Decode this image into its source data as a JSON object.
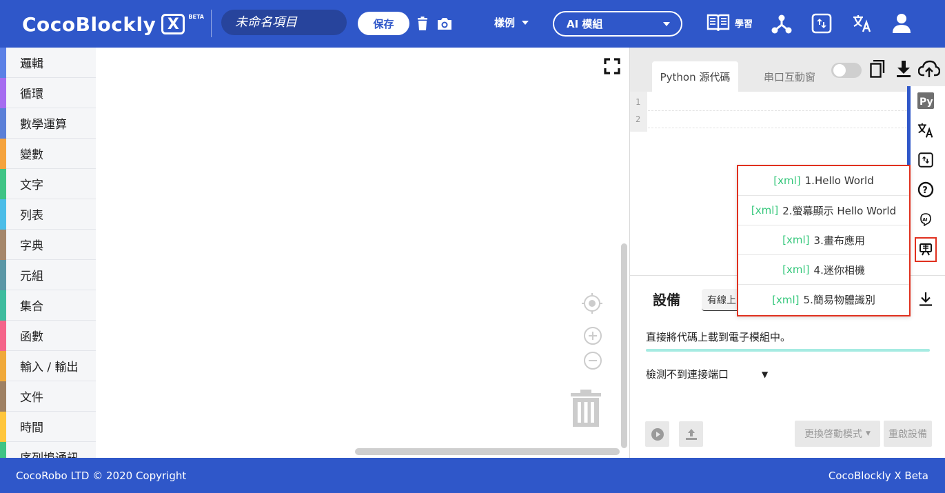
{
  "header": {
    "brand": "CocoBlockly",
    "brand_x": "X",
    "beta": "BETA",
    "project_placeholder": "未命名項目",
    "save_label": "保存",
    "examples_label": "樣例",
    "module_select": "AI 模組",
    "learn_label": "學習"
  },
  "sidebar": {
    "categories": [
      {
        "label": "邏輯",
        "color": "#5b80e6"
      },
      {
        "label": "循環",
        "color": "#a66cf0"
      },
      {
        "label": "數學運算",
        "color": "#5a7fd8"
      },
      {
        "label": "變數",
        "color": "#f5a33d"
      },
      {
        "label": "文字",
        "color": "#3fc485"
      },
      {
        "label": "列表",
        "color": "#4bbde8"
      },
      {
        "label": "字典",
        "color": "#a5876b"
      },
      {
        "label": "元組",
        "color": "#5b97a6"
      },
      {
        "label": "集合",
        "color": "#3ebc9e"
      },
      {
        "label": "函數",
        "color": "#f5648a"
      },
      {
        "label": "輸入 / 輸出",
        "color": "#f0a93a"
      },
      {
        "label": "文件",
        "color": "#9e8063"
      },
      {
        "label": "時間",
        "color": "#ffc63c"
      },
      {
        "label": "序列埠通訊",
        "color": "#3fc485"
      }
    ]
  },
  "editor": {
    "tab_python": "Python 源代碼",
    "tab_serial": "串口互動窗",
    "line_numbers": [
      "1",
      "2"
    ]
  },
  "examples_menu": {
    "tag": "[xml]",
    "items": [
      "1.Hello World",
      "2.螢幕顯示 Hello World",
      "3.畫布應用",
      "4.迷你相機",
      "5.簡易物體識別"
    ]
  },
  "device": {
    "title": "設備",
    "connection_tab": "有線上",
    "description": "直接將代碼上載到電子模組中。",
    "port_status": "檢測不到連接端口",
    "switch_mode_label": "更換啓動模式",
    "restart_label": "重啟設備"
  },
  "footer": {
    "left": "CocoRobo LTD © 2020 Copyright",
    "right": "CocoBlockly X Beta"
  },
  "colors": {
    "primary": "#2f57c9",
    "menu_border": "#e0301e",
    "xml_tag": "#33c77a",
    "progress": "#a6ebe2"
  }
}
